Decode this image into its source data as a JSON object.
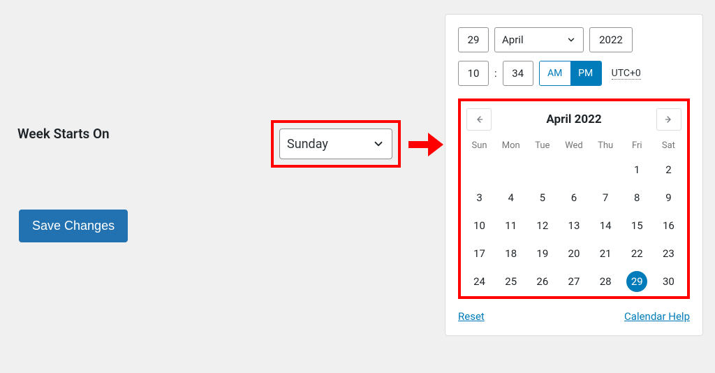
{
  "setting": {
    "label": "Week Starts On",
    "value": "Sunday",
    "save_label": "Save Changes"
  },
  "picker": {
    "day": "29",
    "month": "April",
    "year": "2022",
    "hour": "10",
    "minute": "34",
    "am": "AM",
    "pm": "PM",
    "tz": "UTC+0"
  },
  "calendar": {
    "title": "April 2022",
    "dow": [
      "Sun",
      "Mon",
      "Tue",
      "Wed",
      "Thu",
      "Fri",
      "Sat"
    ],
    "selected": 29,
    "grid": [
      "",
      "",
      "",
      "",
      "",
      "1",
      "2",
      "3",
      "4",
      "5",
      "6",
      "7",
      "8",
      "9",
      "10",
      "11",
      "12",
      "13",
      "14",
      "15",
      "16",
      "17",
      "18",
      "19",
      "20",
      "21",
      "22",
      "23",
      "24",
      "25",
      "26",
      "27",
      "28",
      "29",
      "30"
    ]
  },
  "links": {
    "reset": "Reset",
    "help": "Calendar Help"
  }
}
